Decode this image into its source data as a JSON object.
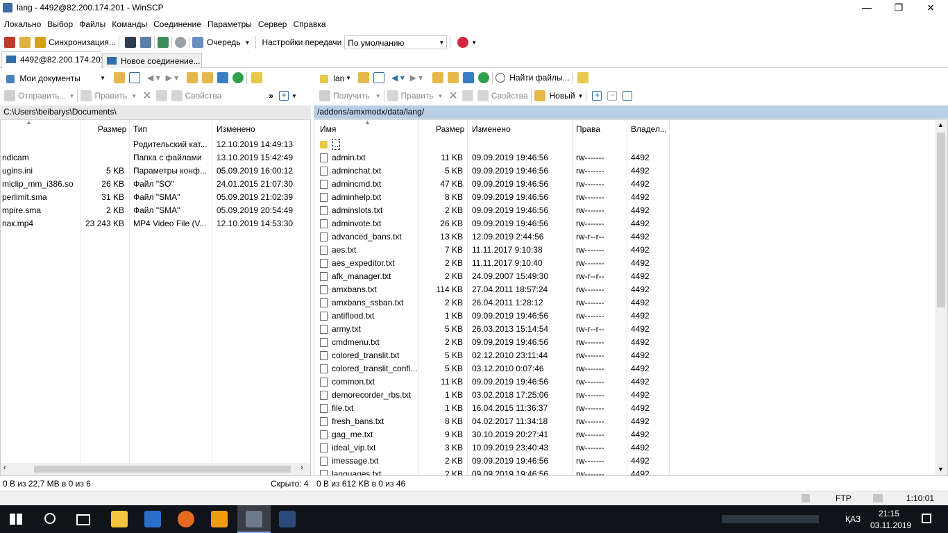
{
  "window": {
    "title": "lang - 4492@82.200.174.201 - WinSCP",
    "min": "—",
    "max": "❐",
    "close": "✕"
  },
  "menu": [
    "Локально",
    "Выбор",
    "Файлы",
    "Команды",
    "Соединение",
    "Параметры",
    "Сервер",
    "Справка"
  ],
  "toolbar": {
    "sync_label": "Синхронизация...",
    "queue_label": "Очередь",
    "transfer_settings_label": "Настройки передачи",
    "transfer_preset": "По умолчанию"
  },
  "tabs": [
    {
      "label": "4492@82.200.174.201"
    },
    {
      "label": "Новое соединение..."
    }
  ],
  "left": {
    "location": "Мои документы",
    "actions": {
      "send": "Отправить...",
      "edit": "Править",
      "props": "Свойства"
    },
    "path": "C:\\Users\\beibarys\\Documents\\",
    "columns": {
      "size": "Размер",
      "type": "Тип",
      "modified": "Изменено"
    },
    "rows": [
      {
        "name": "",
        "size": "",
        "type": "Родительский кат...",
        "modified": "12.10.2019  14:49:13"
      },
      {
        "name": "ndicam",
        "size": "",
        "type": "Папка с файлами",
        "modified": "13.10.2019  15:42:49"
      },
      {
        "name": "ugins.ini",
        "size": "5 KB",
        "type": "Параметры конф...",
        "modified": "05.09.2019  16:00:12"
      },
      {
        "name": "miclip_mm_i386.so",
        "size": "26 KB",
        "type": "Файл \"SO\"",
        "modified": "24.01.2015  21:07:30"
      },
      {
        "name": "perlimit.sma",
        "size": "31 KB",
        "type": "Файл \"SMA\"",
        "modified": "05.09.2019  21:02:39"
      },
      {
        "name": "mpire.sma",
        "size": "2 KB",
        "type": "Файл \"SMA\"",
        "modified": "05.09.2019  20:54:49"
      },
      {
        "name": "пак.mp4",
        "size": "23 243 KB",
        "type": "MP4 Video File (V...",
        "modified": "12.10.2019  14:53:30"
      }
    ],
    "status": "0 B из 22,7 MB в 0 из 6",
    "hidden": "Скрыто: 4"
  },
  "right": {
    "location": "lan",
    "find_label": "Найти файлы...",
    "actions": {
      "receive": "Получить",
      "edit": "Править",
      "props": "Свойства",
      "new": "Новый"
    },
    "path": "/addons/amxmodx/data/lang/",
    "columns": {
      "name": "Имя",
      "size": "Размер",
      "modified": "Изменено",
      "rights": "Права",
      "owner": "Владел..."
    },
    "parent": "..",
    "rows": [
      {
        "name": "admin.txt",
        "size": "11 KB",
        "modified": "09.09.2019 19:46:56",
        "rights": "rw-------",
        "owner": "4492"
      },
      {
        "name": "adminchat.txt",
        "size": "5 KB",
        "modified": "09.09.2019 19:46:56",
        "rights": "rw-------",
        "owner": "4492"
      },
      {
        "name": "admincmd.txt",
        "size": "47 KB",
        "modified": "09.09.2019 19:46:56",
        "rights": "rw-------",
        "owner": "4492"
      },
      {
        "name": "adminhelp.txt",
        "size": "8 KB",
        "modified": "09.09.2019 19:46:56",
        "rights": "rw-------",
        "owner": "4492"
      },
      {
        "name": "adminslots.txt",
        "size": "2 KB",
        "modified": "09.09.2019 19:46:56",
        "rights": "rw-------",
        "owner": "4492"
      },
      {
        "name": "adminvote.txt",
        "size": "26 KB",
        "modified": "09.09.2019 19:46:56",
        "rights": "rw-------",
        "owner": "4492"
      },
      {
        "name": "advanced_bans.txt",
        "size": "13 KB",
        "modified": "12.09.2019 2:44:56",
        "rights": "rw-r--r--",
        "owner": "4492"
      },
      {
        "name": "aes.txt",
        "size": "7 KB",
        "modified": "11.11.2017 9:10:38",
        "rights": "rw-------",
        "owner": "4492"
      },
      {
        "name": "aes_expeditor.txt",
        "size": "2 KB",
        "modified": "11.11.2017 9:10:40",
        "rights": "rw-------",
        "owner": "4492"
      },
      {
        "name": "afk_manager.txt",
        "size": "2 KB",
        "modified": "24.09.2007 15:49:30",
        "rights": "rw-r--r--",
        "owner": "4492"
      },
      {
        "name": "amxbans.txt",
        "size": "114 KB",
        "modified": "27.04.2011 18:57:24",
        "rights": "rw-------",
        "owner": "4492"
      },
      {
        "name": "amxbans_ssban.txt",
        "size": "2 KB",
        "modified": "26.04.2011 1:28:12",
        "rights": "rw-------",
        "owner": "4492"
      },
      {
        "name": "antiflood.txt",
        "size": "1 KB",
        "modified": "09.09.2019 19:46:56",
        "rights": "rw-------",
        "owner": "4492"
      },
      {
        "name": "army.txt",
        "size": "5 KB",
        "modified": "26.03.2013 15:14:54",
        "rights": "rw-r--r--",
        "owner": "4492"
      },
      {
        "name": "cmdmenu.txt",
        "size": "2 KB",
        "modified": "09.09.2019 19:46:56",
        "rights": "rw-------",
        "owner": "4492"
      },
      {
        "name": "colored_translit.txt",
        "size": "5 KB",
        "modified": "02.12.2010 23:11:44",
        "rights": "rw-------",
        "owner": "4492"
      },
      {
        "name": "colored_translit_confi...",
        "size": "5 KB",
        "modified": "03.12.2010 0:07:46",
        "rights": "rw-------",
        "owner": "4492"
      },
      {
        "name": "common.txt",
        "size": "11 KB",
        "modified": "09.09.2019 19:46:56",
        "rights": "rw-------",
        "owner": "4492"
      },
      {
        "name": "demorecorder_rbs.txt",
        "size": "1 KB",
        "modified": "03.02.2018 17:25:06",
        "rights": "rw-------",
        "owner": "4492"
      },
      {
        "name": "file.txt",
        "size": "1 KB",
        "modified": "16.04.2015 11:36:37",
        "rights": "rw-------",
        "owner": "4492"
      },
      {
        "name": "fresh_bans.txt",
        "size": "8 KB",
        "modified": "04.02.2017 11:34:18",
        "rights": "rw-------",
        "owner": "4492"
      },
      {
        "name": "gag_me.txt",
        "size": "9 KB",
        "modified": "30.10.2019 20:27:41",
        "rights": "rw-------",
        "owner": "4492"
      },
      {
        "name": "ideal_vip.txt",
        "size": "3 KB",
        "modified": "10.09.2019 23:40:43",
        "rights": "rw-------",
        "owner": "4492"
      },
      {
        "name": "imessage.txt",
        "size": "2 KB",
        "modified": "09.09.2019 19:46:56",
        "rights": "rw-------",
        "owner": "4492"
      },
      {
        "name": "languages.txt",
        "size": "2 KB",
        "modified": "09.09.2019 19:46:56",
        "rights": "rw-------",
        "owner": "4492"
      }
    ],
    "status": "0 B из 612 KB в 0 из 46"
  },
  "statusbar": {
    "protocol": "FTP",
    "time": "1:10:01"
  },
  "taskbar": {
    "lang": "ҚАЗ",
    "clock_time": "21:15",
    "clock_date": "03.11.2019"
  },
  "colors": {
    "path_active": "#b9cde5",
    "path_inactive": "#e8e8e8",
    "taskbar": "#101418"
  }
}
